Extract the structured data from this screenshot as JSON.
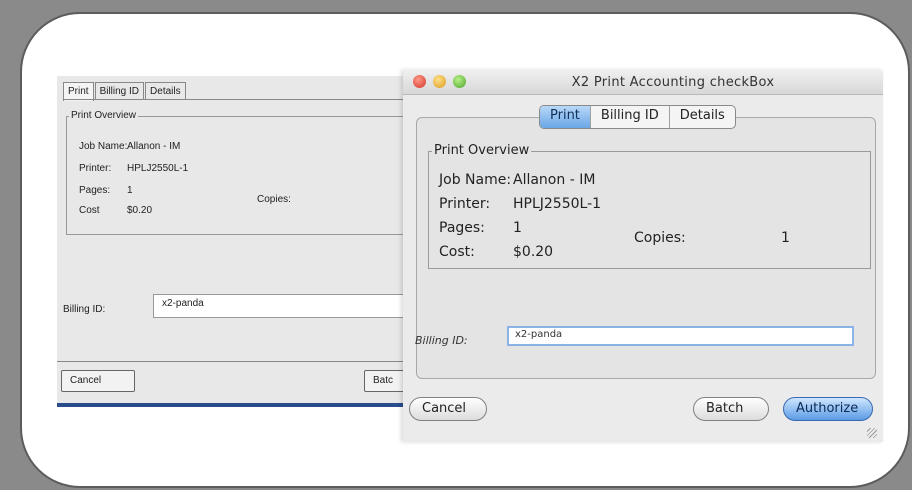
{
  "left_window": {
    "tabs": [
      "Print",
      "Billing ID",
      "Details"
    ],
    "group_title": "Print Overview",
    "job_name_label": "Job Name:",
    "job_name_value": "Allanon - IM",
    "printer_label": "Printer:",
    "printer_value": "HPLJ2550L-1",
    "pages_label": "Pages:",
    "pages_value": "1",
    "copies_label": "Copies:",
    "cost_label": "Cost",
    "cost_value": "$0.20",
    "billing_label": "Billing ID:",
    "billing_value": "x2-panda",
    "cancel_label": "Cancel",
    "batch_label": "Batc"
  },
  "right_window": {
    "title": "X2 Print Accounting checkBox",
    "tabs": [
      "Print",
      "Billing ID",
      "Details"
    ],
    "active_tab": "Print",
    "group_title": "Print Overview",
    "job_name_label": "Job Name:",
    "job_name_value": "Allanon - IM",
    "printer_label": "Printer:",
    "printer_value": "HPLJ2550L-1",
    "pages_label": "Pages:",
    "pages_value": "1",
    "copies_label": "Copies:",
    "copies_value": "1",
    "cost_label": "Cost:",
    "cost_value": "$0.20",
    "billing_label": "Billing ID:",
    "billing_value": "x2-panda",
    "cancel_label": "Cancel",
    "batch_label": "Batch",
    "authorize_label": "Authorize"
  },
  "colors": {
    "accent_blue": "#5b9be4",
    "windows_bar": "#2a4c8c"
  }
}
